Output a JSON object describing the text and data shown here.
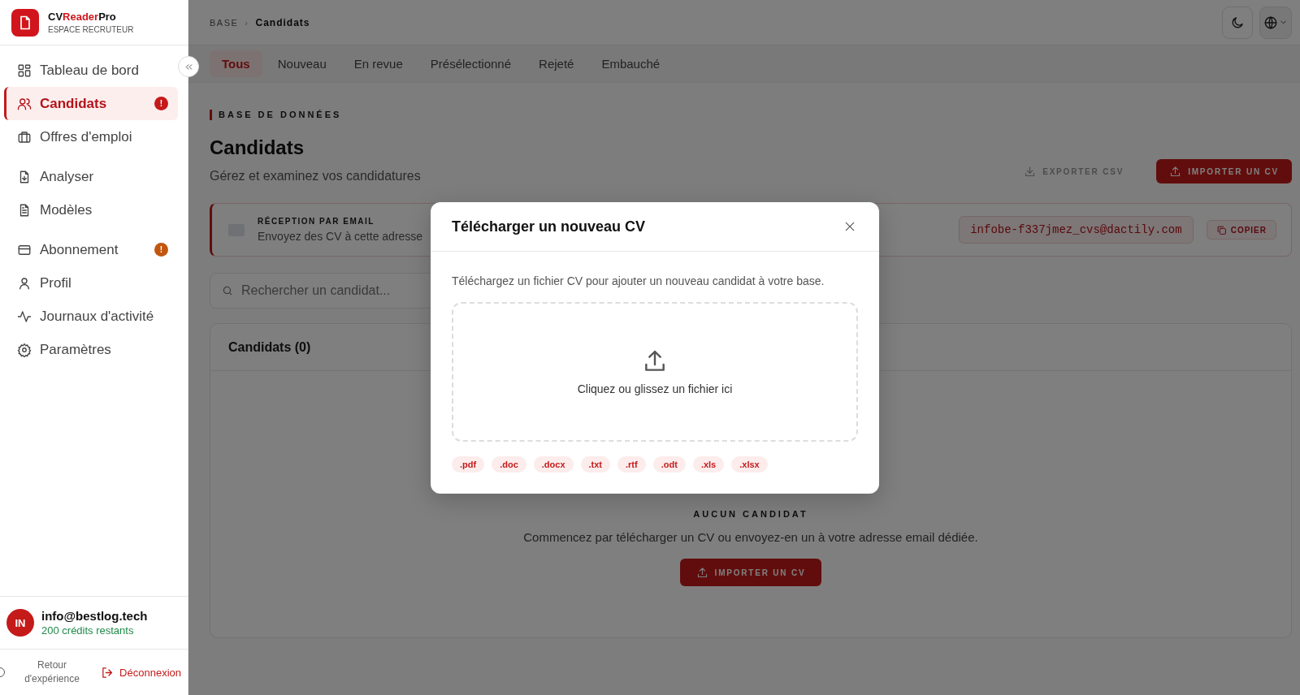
{
  "brand": {
    "name": [
      {
        "text": "CV",
        "accent": false
      },
      {
        "text": "Reader",
        "accent": true
      },
      {
        "text": "Pro",
        "accent": false
      }
    ],
    "subtitle": "ESPACE RECRUTEUR"
  },
  "sidebar": {
    "groups": [
      {
        "items": [
          {
            "label": "Tableau de bord",
            "selected": false
          },
          {
            "label": "Candidats",
            "selected": true,
            "badge": "!",
            "color": "#c41a1a"
          },
          {
            "label": "Offres d'emploi",
            "selected": false
          }
        ]
      },
      {
        "items": [
          {
            "label": "Analyser",
            "selected": false
          },
          {
            "label": "Modèles",
            "selected": false
          }
        ]
      },
      {
        "items": [
          {
            "label": "Abonnement",
            "selected": false,
            "badge": "!",
            "color": "#c2560f"
          },
          {
            "label": "Profil",
            "selected": false
          },
          {
            "label": "Journaux d'activité",
            "selected": false
          },
          {
            "label": "Paramètres",
            "selected": false
          }
        ]
      }
    ]
  },
  "user": {
    "initials": "IN",
    "email": "info@bestlog.tech",
    "credits": "200 crédits restants"
  },
  "footer": {
    "feedback": "Retour d'expérience",
    "logout": "Déconnexion"
  },
  "breadcrumb": {
    "items": [
      "BASE",
      "Candidats"
    ],
    "separator": "›"
  },
  "tabs": [
    {
      "label": "Tous",
      "selected": true
    },
    {
      "label": "Nouveau",
      "selected": false
    },
    {
      "label": "En revue",
      "selected": false
    },
    {
      "label": "Présélectionné",
      "selected": false
    },
    {
      "label": "Rejeté",
      "selected": false
    },
    {
      "label": "Embauché",
      "selected": false
    }
  ],
  "page": {
    "section_label": "BASE DE DONNÉES",
    "title": "Candidats",
    "subtitle": "Gérez et examinez vos candidatures",
    "actions": [
      {
        "label": "EXPORTER CSV",
        "kind": "ghost"
      },
      {
        "label": "IMPORTER UN CV",
        "kind": "primary"
      }
    ]
  },
  "email_card": {
    "title": "RÉCEPTION PAR EMAIL",
    "text": "Envoyez des CV à cette adresse",
    "address": "infobe-f337jmez_cvs@dactily.com",
    "copy": "COPIER"
  },
  "search": {
    "placeholder": "Rechercher un candidat..."
  },
  "candidates": {
    "title": "Candidats (0)",
    "empty_title": "AUCUN CANDIDAT",
    "empty_text": "Commencez par télécharger un CV ou envoyez-en un à votre adresse email dédiée.",
    "button": "IMPORTER UN CV"
  },
  "modal": {
    "title": "Télécharger un nouveau CV",
    "description": "Téléchargez un fichier CV pour ajouter un nouveau candidat à votre base.",
    "dropzone": "Cliquez ou glissez un fichier ici",
    "formats": [
      ".pdf",
      ".doc",
      ".docx",
      ".txt",
      ".rtf",
      ".odt",
      ".xls",
      ".xlsx"
    ]
  }
}
